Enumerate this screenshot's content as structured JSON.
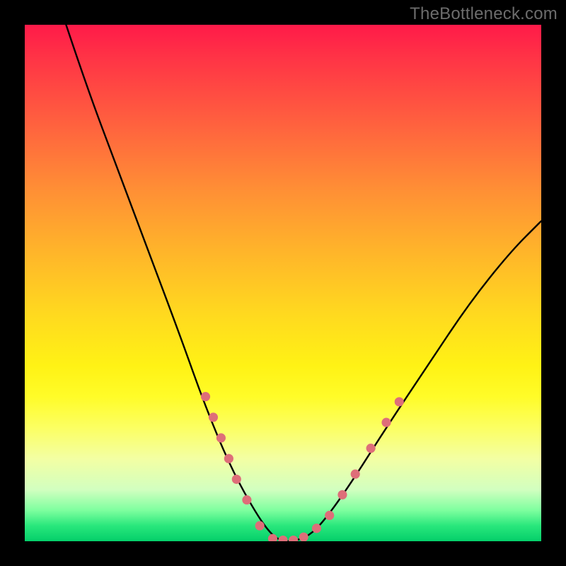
{
  "watermark": "TheBottleneck.com",
  "chart_data": {
    "type": "line",
    "title": "",
    "xlabel": "",
    "ylabel": "",
    "xlim": [
      0,
      100
    ],
    "ylim": [
      0,
      100
    ],
    "grid": false,
    "legend": false,
    "background": "rainbow-vertical-gradient",
    "series": [
      {
        "name": "bottleneck-curve",
        "color": "#000000",
        "points": [
          {
            "x": 8,
            "y": 100
          },
          {
            "x": 12,
            "y": 88
          },
          {
            "x": 18,
            "y": 72
          },
          {
            "x": 24,
            "y": 56
          },
          {
            "x": 30,
            "y": 40
          },
          {
            "x": 35,
            "y": 26
          },
          {
            "x": 40,
            "y": 14
          },
          {
            "x": 45,
            "y": 5
          },
          {
            "x": 48,
            "y": 1
          },
          {
            "x": 50,
            "y": 0
          },
          {
            "x": 52,
            "y": 0
          },
          {
            "x": 55,
            "y": 1
          },
          {
            "x": 58,
            "y": 4
          },
          {
            "x": 63,
            "y": 11
          },
          {
            "x": 70,
            "y": 22
          },
          {
            "x": 78,
            "y": 34
          },
          {
            "x": 86,
            "y": 46
          },
          {
            "x": 94,
            "y": 56
          },
          {
            "x": 100,
            "y": 62
          }
        ]
      }
    ],
    "markers": {
      "color": "#de6e79",
      "radius_pct": 0.9,
      "points": [
        {
          "x": 35.0,
          "y": 28
        },
        {
          "x": 36.5,
          "y": 24
        },
        {
          "x": 38.0,
          "y": 20
        },
        {
          "x": 39.5,
          "y": 16
        },
        {
          "x": 41.0,
          "y": 12
        },
        {
          "x": 43.0,
          "y": 8
        },
        {
          "x": 45.5,
          "y": 3
        },
        {
          "x": 48.0,
          "y": 0.5
        },
        {
          "x": 50.0,
          "y": 0.2
        },
        {
          "x": 52.0,
          "y": 0.2
        },
        {
          "x": 54.0,
          "y": 0.8
        },
        {
          "x": 56.5,
          "y": 2.5
        },
        {
          "x": 59.0,
          "y": 5
        },
        {
          "x": 61.5,
          "y": 9
        },
        {
          "x": 64.0,
          "y": 13
        },
        {
          "x": 67.0,
          "y": 18
        },
        {
          "x": 70.0,
          "y": 23
        },
        {
          "x": 72.5,
          "y": 27
        }
      ]
    }
  }
}
